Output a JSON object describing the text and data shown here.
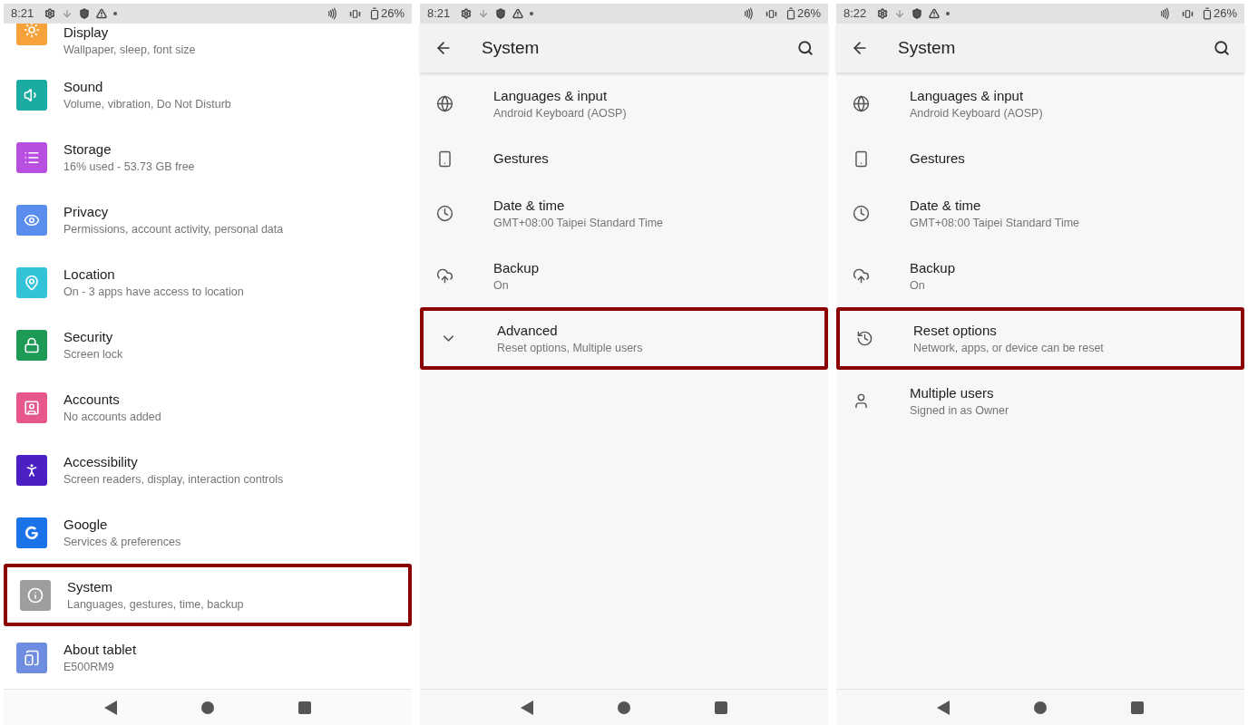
{
  "screens": [
    {
      "status_bar": {
        "time": "8:21",
        "battery": "26%"
      },
      "rows": [
        {
          "title": "Display",
          "subtitle": "Wallpaper, sleep, font size",
          "color": "#f5a23a",
          "highlighted": false
        },
        {
          "title": "Sound",
          "subtitle": "Volume, vibration, Do Not Disturb",
          "color": "#1aaba3",
          "highlighted": false
        },
        {
          "title": "Storage",
          "subtitle": "16% used - 53.73 GB free",
          "color": "#b84fe0",
          "highlighted": false
        },
        {
          "title": "Privacy",
          "subtitle": "Permissions, account activity, personal data",
          "color": "#5b8def",
          "highlighted": false
        },
        {
          "title": "Location",
          "subtitle": "On - 3 apps have access to location",
          "color": "#33c3d9",
          "highlighted": false
        },
        {
          "title": "Security",
          "subtitle": "Screen lock",
          "color": "#1e9a57",
          "highlighted": false
        },
        {
          "title": "Accounts",
          "subtitle": "No accounts added",
          "color": "#e6588c",
          "highlighted": false
        },
        {
          "title": "Accessibility",
          "subtitle": "Screen readers, display, interaction controls",
          "color": "#4a1fc4",
          "highlighted": false
        },
        {
          "title": "Google",
          "subtitle": "Services & preferences",
          "color": "#1a73e8",
          "highlighted": false
        },
        {
          "title": "System",
          "subtitle": "Languages, gestures, time, backup",
          "color": "#9e9e9e",
          "highlighted": true
        },
        {
          "title": "About tablet",
          "subtitle": "E500RM9",
          "color": "#6f8de0",
          "highlighted": false
        }
      ]
    },
    {
      "status_bar": {
        "time": "8:21",
        "battery": "26%"
      },
      "header": {
        "title": "System"
      },
      "rows": [
        {
          "title": "Languages & input",
          "subtitle": "Android Keyboard (AOSP)",
          "highlighted": false
        },
        {
          "title": "Gestures",
          "highlighted": false
        },
        {
          "title": "Date & time",
          "subtitle": "GMT+08:00 Taipei Standard Time",
          "highlighted": false
        },
        {
          "title": "Backup",
          "subtitle": "On",
          "highlighted": false
        },
        {
          "title": "Advanced",
          "subtitle": "Reset options, Multiple users",
          "highlighted": true
        }
      ]
    },
    {
      "status_bar": {
        "time": "8:22",
        "battery": "26%"
      },
      "header": {
        "title": "System"
      },
      "rows": [
        {
          "title": "Languages & input",
          "subtitle": "Android Keyboard (AOSP)",
          "highlighted": false
        },
        {
          "title": "Gestures",
          "highlighted": false
        },
        {
          "title": "Date & time",
          "subtitle": "GMT+08:00 Taipei Standard Time",
          "highlighted": false
        },
        {
          "title": "Backup",
          "subtitle": "On",
          "highlighted": false
        },
        {
          "title": "Reset options",
          "subtitle": "Network, apps, or device can be reset",
          "highlighted": true
        },
        {
          "title": "Multiple users",
          "subtitle": "Signed in as Owner",
          "highlighted": false
        }
      ]
    }
  ]
}
